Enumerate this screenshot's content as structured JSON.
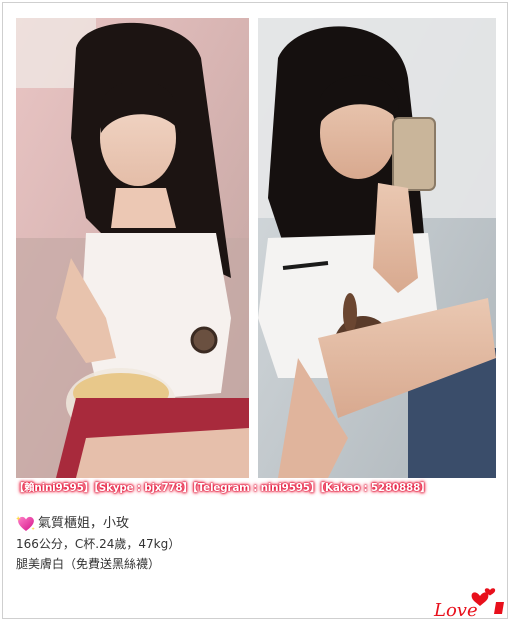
{
  "contact": {
    "line": "【賴nini9595】【Skype : bjx778】【Telegram : nini9595】【Kakao : 5280888】"
  },
  "profile": {
    "heart_icon": "sparkling-heart-icon",
    "title": "氣質櫃姐，小玫",
    "stats": "166公分，C杯.24歲，47kg）",
    "note": "腿美膚白（免費送黑絲襪）"
  },
  "logo": {
    "text": "Love",
    "color": "#e8101c"
  },
  "colors": {
    "glow": "#e0002a",
    "text": "#333333"
  }
}
